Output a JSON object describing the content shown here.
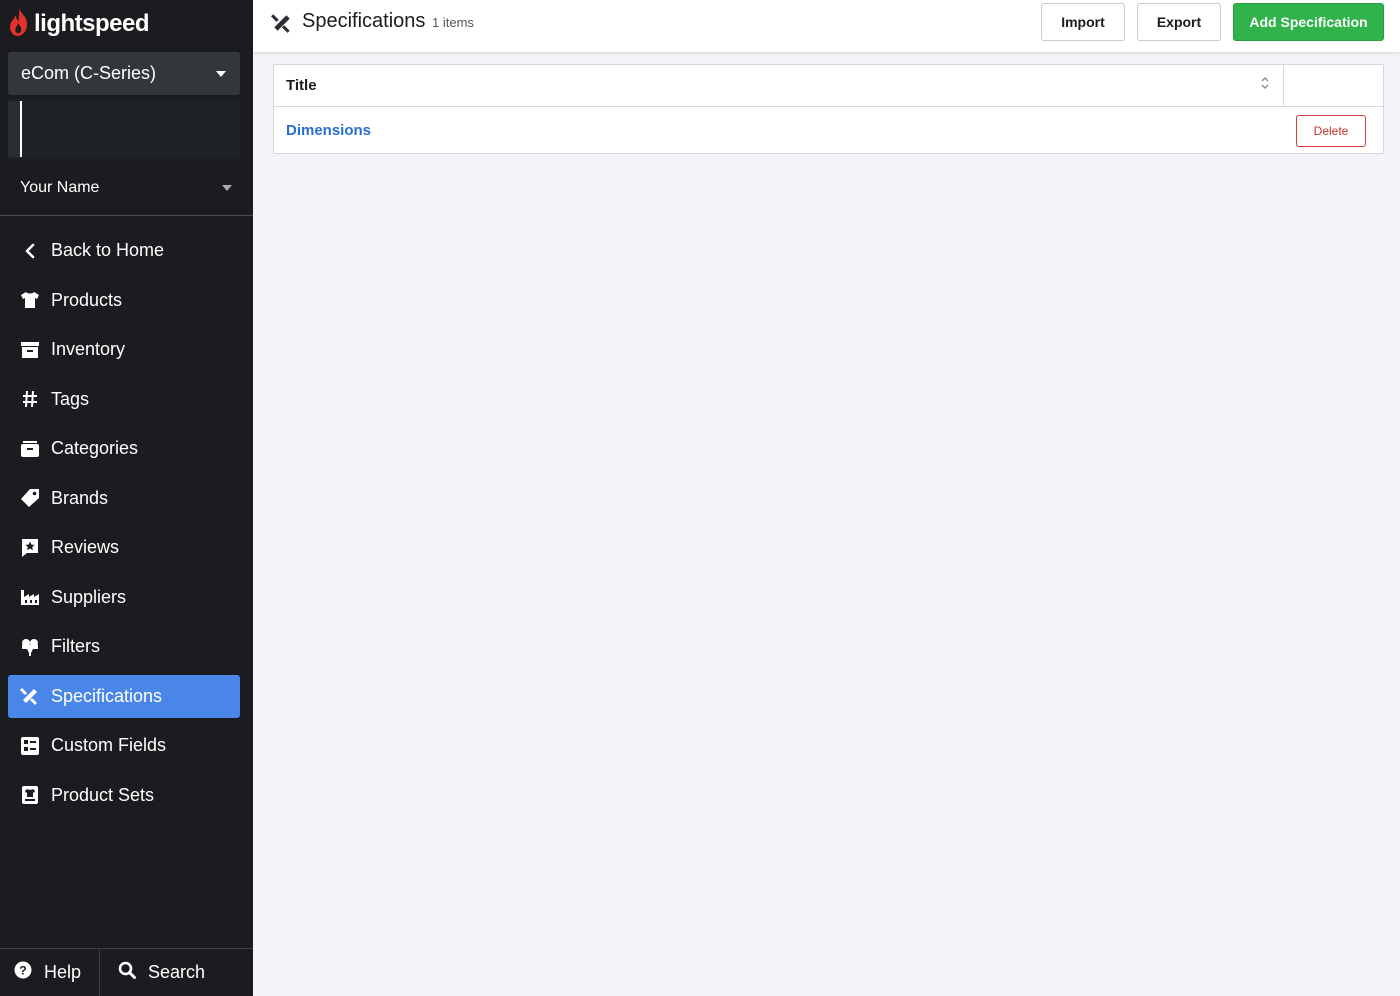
{
  "brand": {
    "logo_text": "lightspeed",
    "accent": "#e0312b"
  },
  "sidebar": {
    "store_select": {
      "label": "eCom (C-Series)"
    },
    "user": {
      "name": "Your Name"
    },
    "items": [
      {
        "label": "Back to Home",
        "icon": "chevron-left-icon"
      },
      {
        "label": "Products",
        "icon": "tshirt-icon"
      },
      {
        "label": "Inventory",
        "icon": "inventory-icon"
      },
      {
        "label": "Tags",
        "icon": "hash-icon"
      },
      {
        "label": "Categories",
        "icon": "folder-icon"
      },
      {
        "label": "Brands",
        "icon": "tag-icon"
      },
      {
        "label": "Reviews",
        "icon": "review-star-icon"
      },
      {
        "label": "Suppliers",
        "icon": "factory-icon"
      },
      {
        "label": "Filters",
        "icon": "filter-icon"
      },
      {
        "label": "Specifications",
        "icon": "ruler-pencil-icon",
        "active": true
      },
      {
        "label": "Custom Fields",
        "icon": "custom-fields-icon"
      },
      {
        "label": "Product Sets",
        "icon": "product-set-icon"
      }
    ],
    "active_color": "#4a86e8",
    "bottom": {
      "help_label": "Help",
      "search_label": "Search"
    }
  },
  "header": {
    "title": "Specifications",
    "count": "1 items",
    "import_label": "Import",
    "export_label": "Export",
    "add_label": "Add Specification",
    "add_color": "#2fb34a"
  },
  "table": {
    "column_title": "Title",
    "rows": [
      {
        "title": "Dimensions",
        "delete_label": "Delete"
      }
    ]
  }
}
